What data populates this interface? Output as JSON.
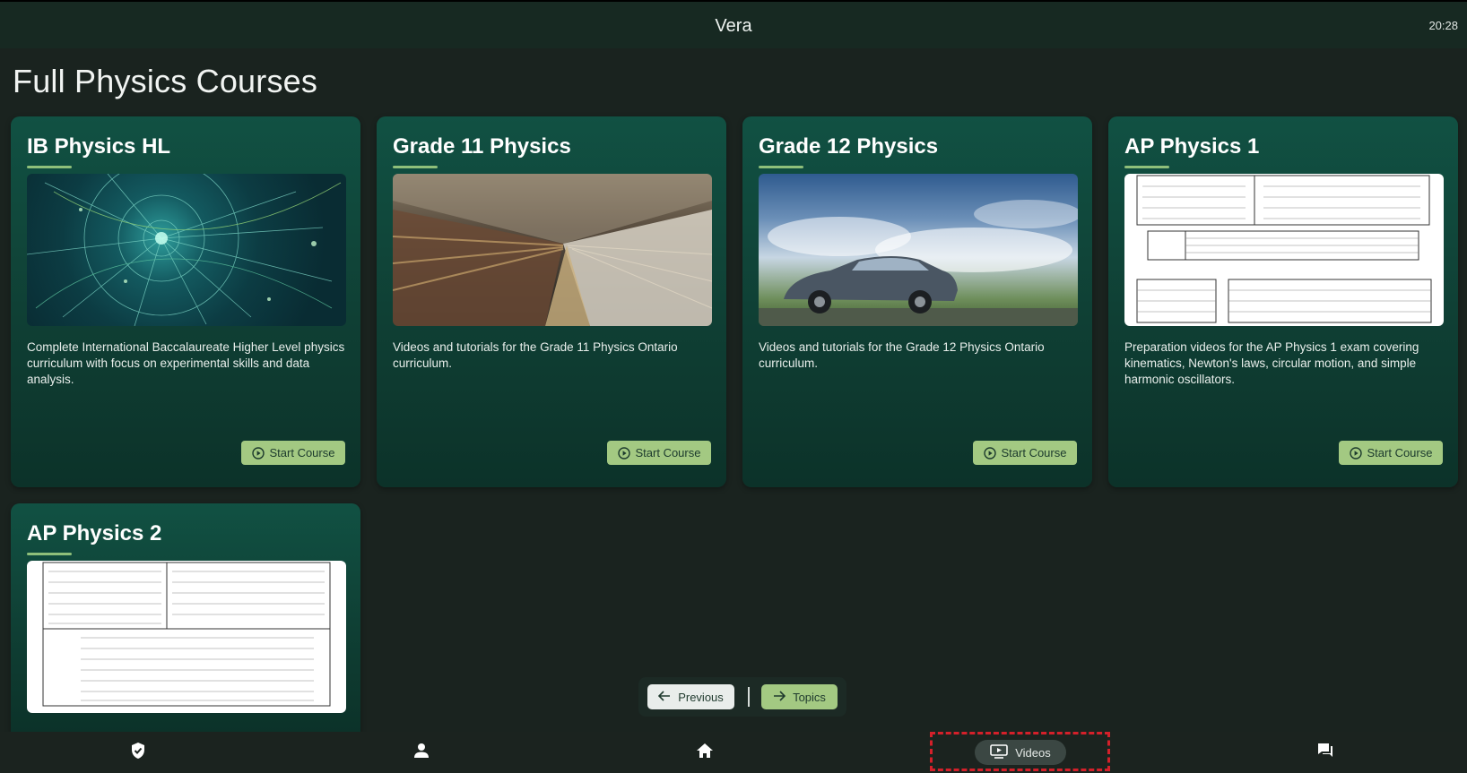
{
  "header": {
    "app_title": "Vera",
    "time": "20:28"
  },
  "page": {
    "title": "Full Physics Courses"
  },
  "courses": [
    {
      "title": "IB Physics HL",
      "description": "Complete International Baccalaureate Higher Level physics curriculum with focus on experimental skills and data analysis.",
      "button": "Start Course",
      "image": "particle-collision-image"
    },
    {
      "title": "Grade 11 Physics",
      "description": "Videos and tutorials for the Grade 11 Physics Ontario curriculum.",
      "button": "Start Course",
      "image": "particle-accelerator-tunnel-image"
    },
    {
      "title": "Grade 12 Physics",
      "description": "Videos and tutorials for the Grade 12 Physics Ontario curriculum.",
      "button": "Start Course",
      "image": "moving-car-image"
    },
    {
      "title": "AP Physics 1",
      "description": "Preparation videos for the AP Physics 1 exam covering kinematics, Newton's laws, circular motion, and simple harmonic oscillators.",
      "button": "Start Course",
      "image": "physics-constants-table-image"
    },
    {
      "title": "AP Physics 2",
      "description": "",
      "button": "",
      "image": "physics-constants-table-image"
    }
  ],
  "pagination": {
    "previous": "Previous",
    "topics": "Topics"
  },
  "bottom_nav": [
    {
      "icon": "shield-check-icon"
    },
    {
      "icon": "person-icon"
    },
    {
      "icon": "home-icon"
    },
    {
      "icon": "video-icon",
      "label": "Videos",
      "active": true
    },
    {
      "icon": "chat-icon"
    }
  ],
  "colors": {
    "accent": "#a3c982",
    "card": "#115143",
    "background": "#1a231f",
    "highlight": "#d4202a"
  }
}
